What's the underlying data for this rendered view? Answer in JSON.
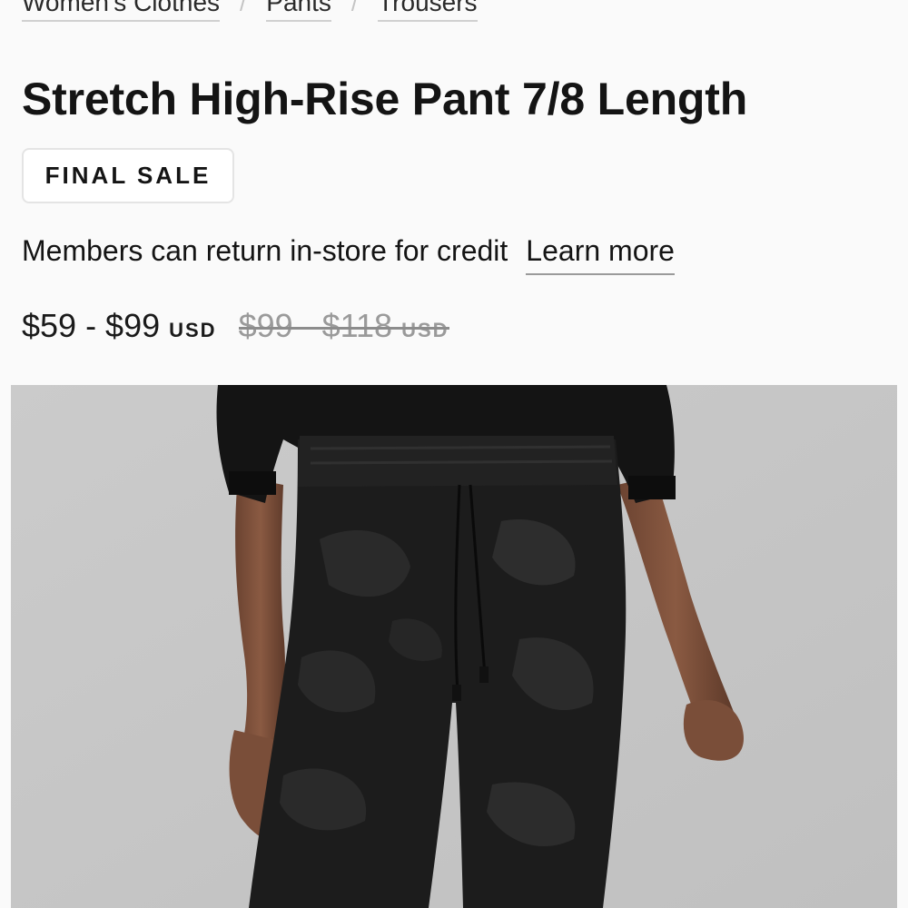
{
  "breadcrumb": [
    {
      "label": "Women's Clothes"
    },
    {
      "label": "Pants"
    },
    {
      "label": "Trousers"
    }
  ],
  "breadcrumb_separator": "/",
  "product": {
    "title": "Stretch High-Rise Pant 7/8 Length",
    "badge": "FINAL SALE",
    "returns_note": "Members can return in-store for credit",
    "learn_more_label": "Learn more",
    "price": {
      "current_range": "$59 - $99",
      "current_currency": "USD",
      "original_range": "$99 - $118",
      "original_currency": "USD"
    }
  },
  "image": {
    "subject": "model wearing black camo high-rise pant with black sweatshirt",
    "background_color": "#c8c8c8",
    "garment_color": "#1c1c1c"
  }
}
